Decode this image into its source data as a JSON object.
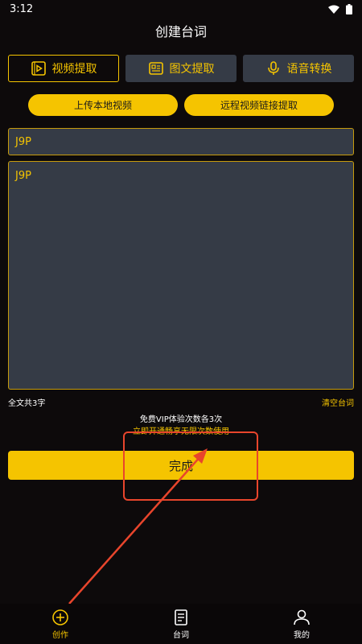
{
  "status": {
    "time": "3:12"
  },
  "header": {
    "title": "创建台词"
  },
  "tabs": [
    {
      "label": "视频提取",
      "icon": "video-extract-icon",
      "active": true
    },
    {
      "label": "图文提取",
      "icon": "image-text-icon",
      "active": false
    },
    {
      "label": "语音转换",
      "icon": "microphone-icon",
      "active": false
    }
  ],
  "actions": {
    "upload_local": "上传本地视频",
    "remote_link": "远程视频链接提取"
  },
  "title_input": {
    "value": "J9P"
  },
  "content": {
    "value": "J9P"
  },
  "stats": {
    "char_count": "全文共3字",
    "clear": "清空台词"
  },
  "vip": {
    "line1": "免费VIP体验次数各3次",
    "line2": "立即开通畅享无限次数使用"
  },
  "done_button": "完成",
  "nav": [
    {
      "label": "创作",
      "icon": "create-plus-icon",
      "active": true
    },
    {
      "label": "台词",
      "icon": "script-document-icon",
      "active": false
    },
    {
      "label": "我的",
      "icon": "profile-person-icon",
      "active": false
    }
  ],
  "colors": {
    "accent": "#f5c400",
    "panel": "#353b46",
    "background": "#0d0a0b",
    "annotation": "#e8452c"
  }
}
